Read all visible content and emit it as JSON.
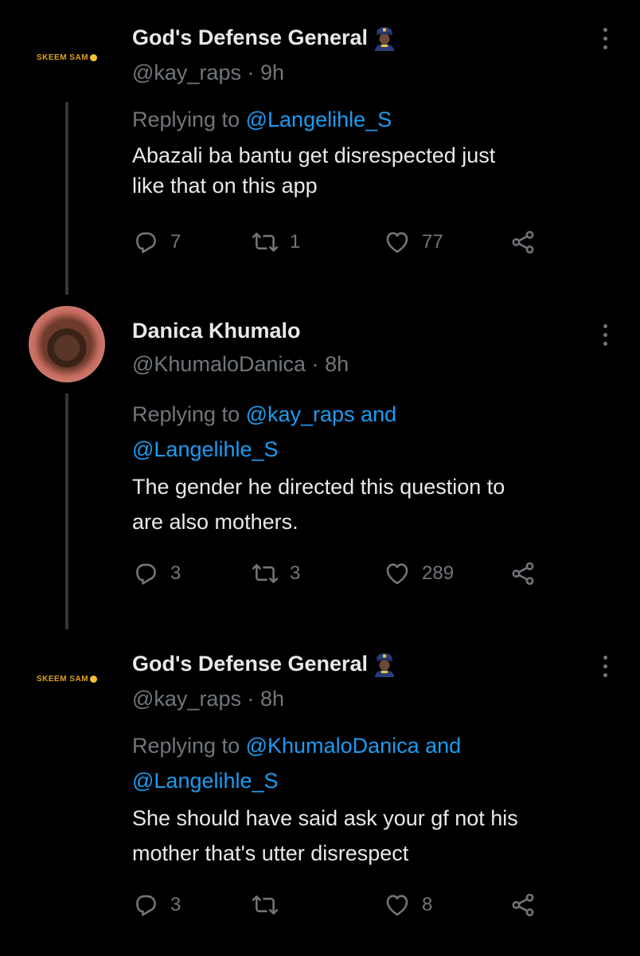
{
  "tweets": [
    {
      "display_name": "God's Defense General",
      "handle": "@kay_raps",
      "time": "9h",
      "avatar_label": "SKEEM SAM",
      "replying_prefix": "Replying to",
      "replying_mentions": "@Langelihle_S",
      "replying_line2": "",
      "text_line1": "Abazali ba bantu get disrespected just",
      "text_line2": "like that on this app",
      "replies": "7",
      "retweets": "1",
      "likes": "77"
    },
    {
      "display_name": "Danica Khumalo",
      "handle": "@KhumaloDanica",
      "time": "8h",
      "replying_prefix": "Replying to",
      "replying_mentions": "@kay_raps and",
      "replying_line2": "@Langelihle_S",
      "text_line1": "The gender he directed this question to",
      "text_line2": "are also mothers.",
      "replies": "3",
      "retweets": "3",
      "likes": "289"
    },
    {
      "display_name": "God's Defense General",
      "handle": "@kay_raps",
      "time": "8h",
      "avatar_label": "SKEEM SAM",
      "replying_prefix": "Replying to",
      "replying_mentions": "@KhumaloDanica and",
      "replying_line2": "@Langelihle_S",
      "text_line1": "She should have said ask your gf not his",
      "text_line2": "mother that's utter disrespect",
      "replies": "3",
      "retweets": "",
      "likes": "8"
    }
  ],
  "separator": "·",
  "colors": {
    "background": "#000000",
    "text": "#e7e9ea",
    "muted": "#71767b",
    "mention": "#1d9bf0",
    "thread_line": "#333639"
  },
  "icons": [
    "reply-icon",
    "retweet-icon",
    "like-icon",
    "share-icon",
    "more-icon",
    "police-officer-emoji"
  ]
}
